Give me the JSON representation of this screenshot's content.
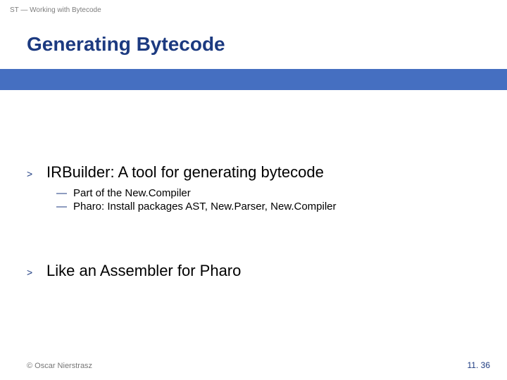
{
  "header": {
    "breadcrumb": "ST — Working with Bytecode",
    "title": "Generating Bytecode"
  },
  "bullets": {
    "major1": {
      "chevron": ">",
      "text": "IRBuilder: A tool for generating bytecode",
      "subs": [
        {
          "dash": "—",
          "text": "Part of the New.Compiler"
        },
        {
          "dash": "—",
          "text": "Pharo: Install packages AST, New.Parser, New.Compiler"
        }
      ]
    },
    "major2": {
      "chevron": ">",
      "text": "Like an Assembler for Pharo"
    }
  },
  "footer": {
    "copyright": "© Oscar Nierstrasz",
    "page": "11. 36"
  }
}
